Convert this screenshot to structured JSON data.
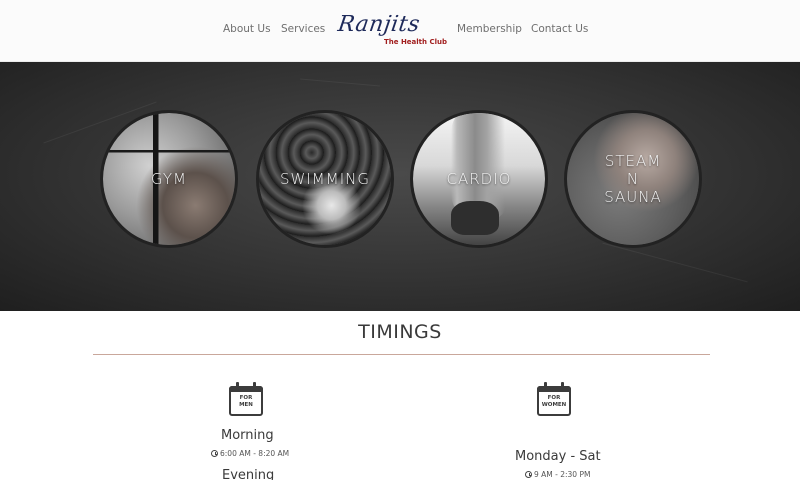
{
  "header": {
    "nav_left": [
      {
        "label": "About Us"
      },
      {
        "label": "Services"
      }
    ],
    "nav_right": [
      {
        "label": "Membership"
      },
      {
        "label": "Contact Us"
      }
    ],
    "logo": {
      "script_text": "Ranjits",
      "subtitle": "The Health Club"
    }
  },
  "services": [
    {
      "label": "GYM"
    },
    {
      "label": "SWIMMING"
    },
    {
      "label": "CARDIO"
    },
    {
      "label_lines": [
        "STEAM",
        "N",
        "SAUNA"
      ]
    }
  ],
  "timings": {
    "title": "TIMINGS",
    "men": {
      "icon_text": [
        "FOR",
        "MEN"
      ],
      "slots": [
        {
          "heading": "Morning",
          "time": "6:00 AM - 8:20 AM"
        },
        {
          "heading": "Evening"
        }
      ]
    },
    "women": {
      "icon_text": [
        "FOR",
        "WOMEN"
      ],
      "slots": [
        {
          "heading": "Monday - Sat",
          "time": "9 AM - 2:30 PM"
        }
      ]
    }
  },
  "colors": {
    "divider": "#c9a79b",
    "logo_script": "#1e2a5a",
    "logo_subtitle": "#a11e1e",
    "hero_background": "#333333"
  },
  "icons": [
    "calendar-icon",
    "clock-icon"
  ]
}
